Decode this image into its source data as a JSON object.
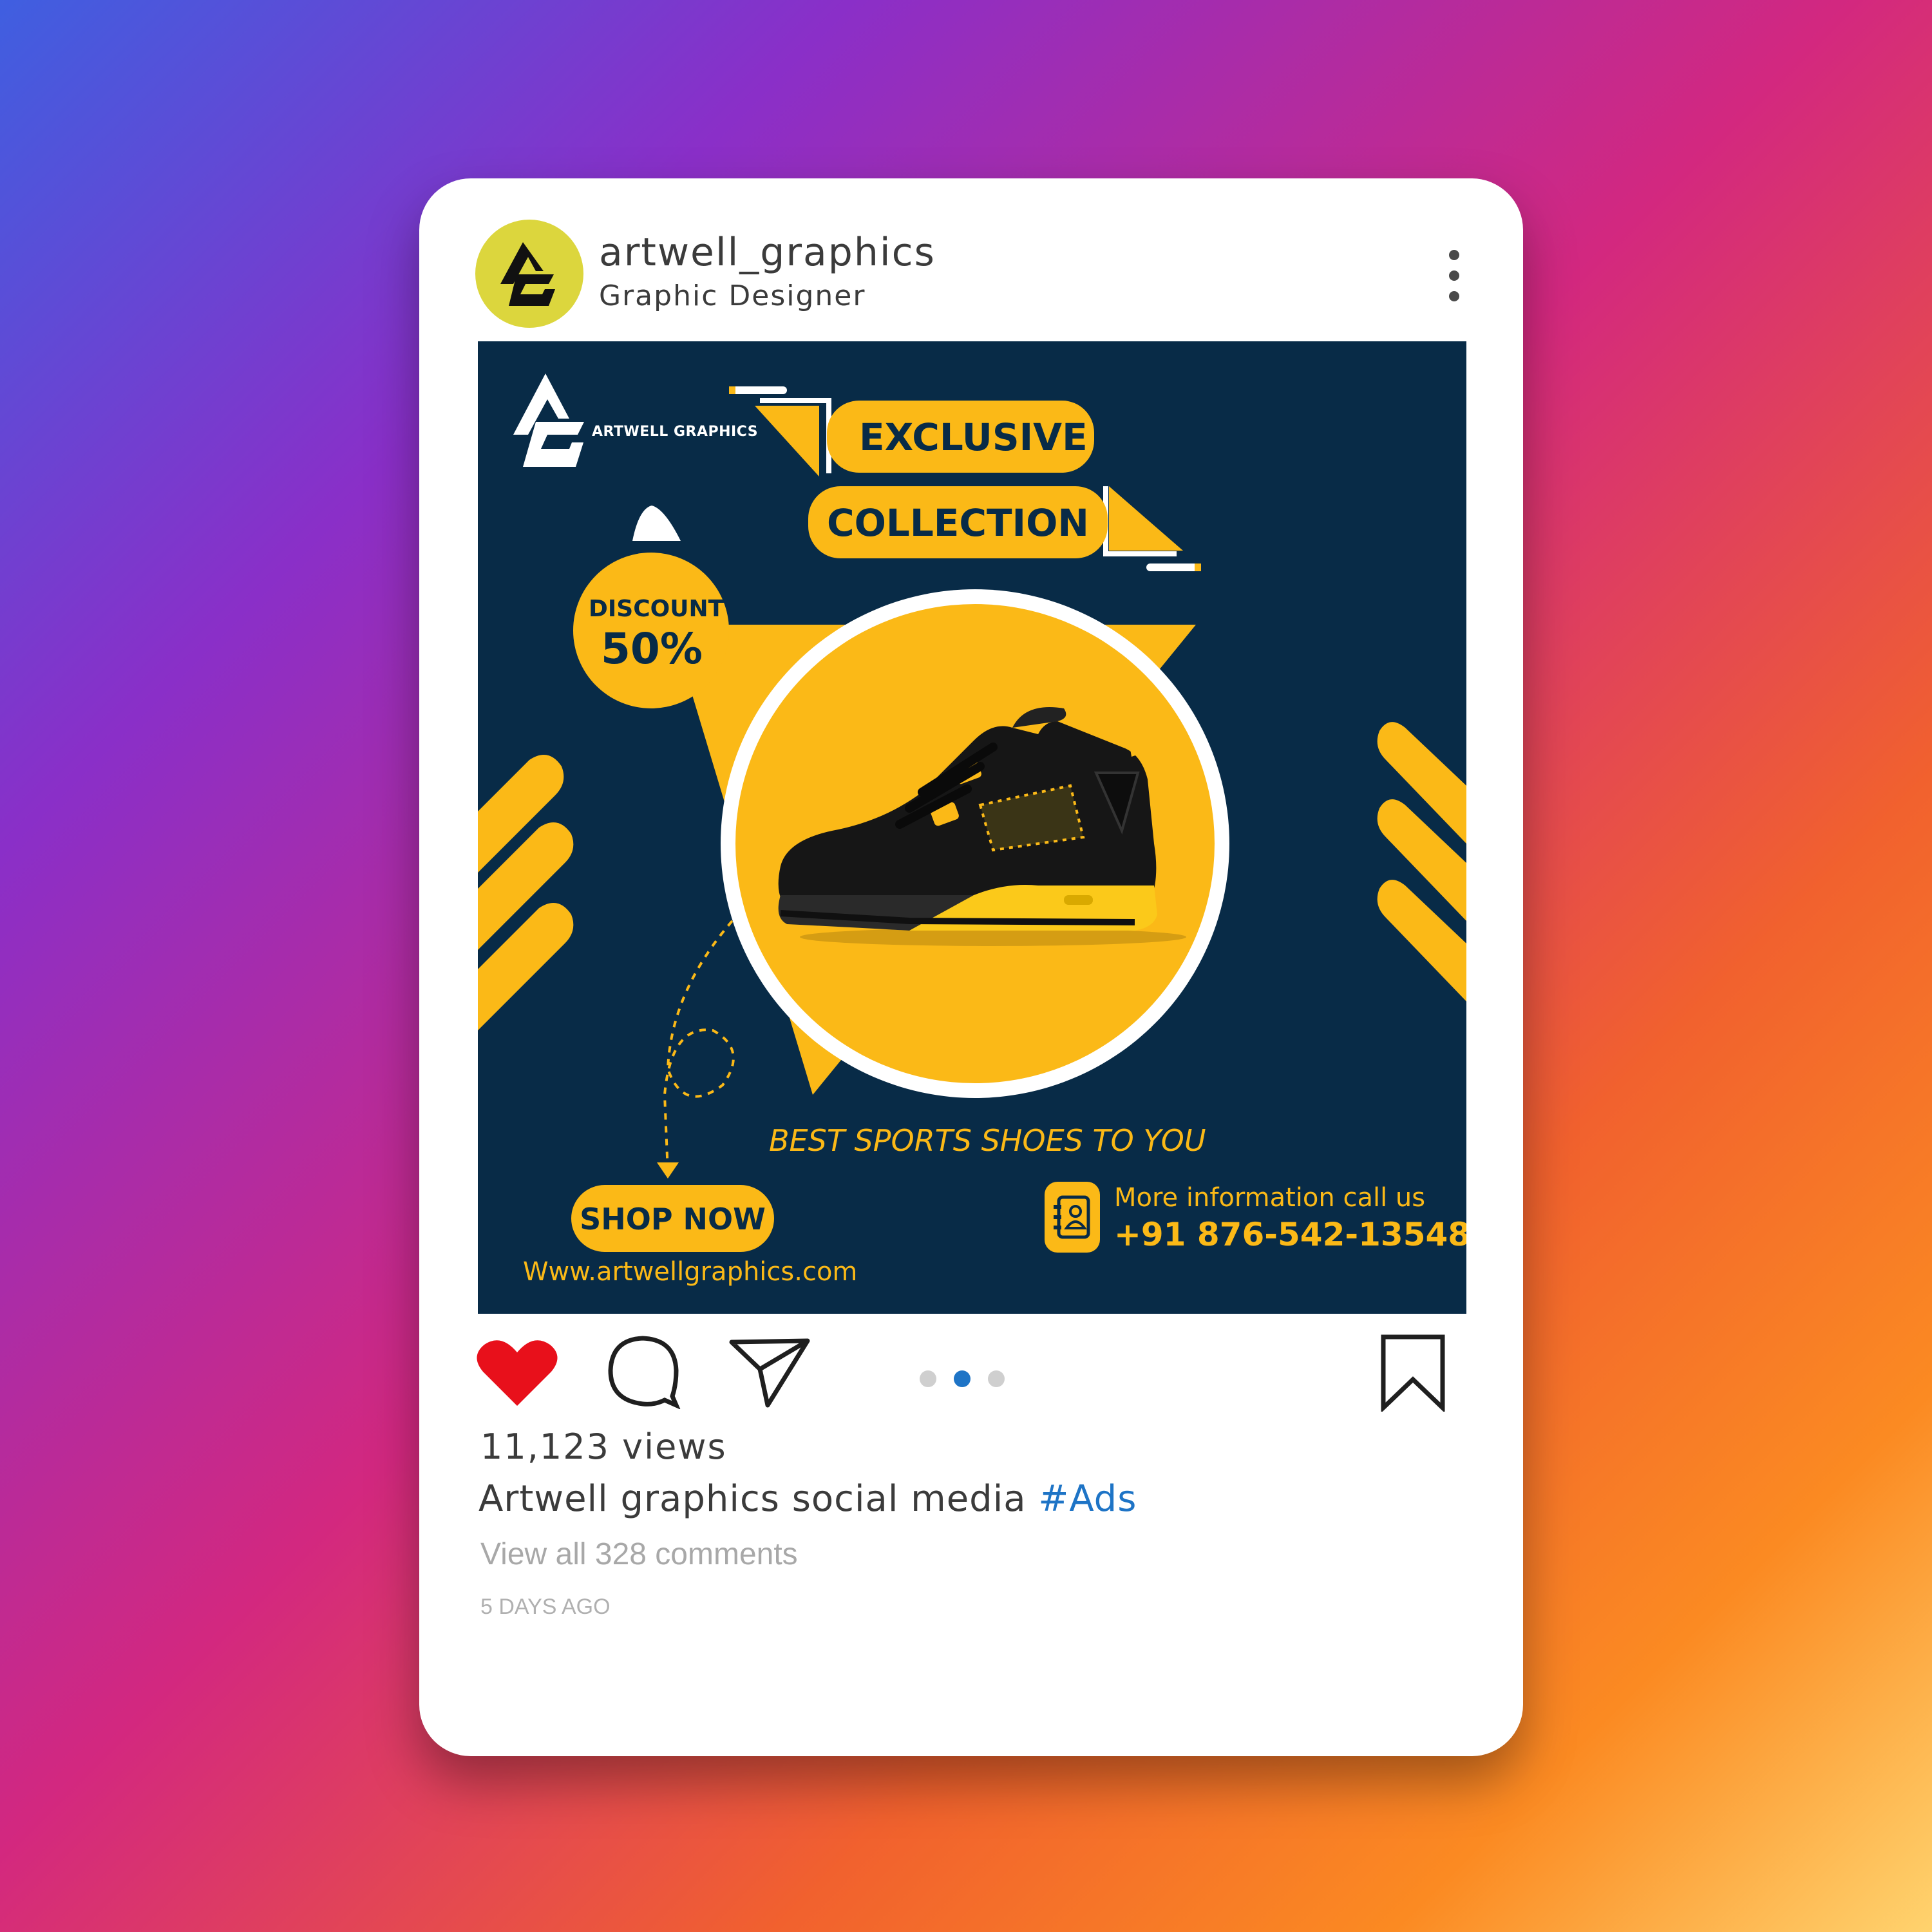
{
  "profile": {
    "username": "artwell_graphics",
    "subtitle": "Graphic Designer",
    "avatar_letters": "AG"
  },
  "post": {
    "brand": "ARTWELL GRAPHICS",
    "headline_1": "EXCLUSIVE",
    "headline_2": "COLLECTION",
    "discount_label": "DISCOUNT",
    "discount_value": "50%",
    "tagline": "BEST SPORTS SHOES TO YOU",
    "cta": "SHOP NOW",
    "website": "Www.artwellgraphics.com",
    "contact_label": "More information call us",
    "phone": "+91 876-542-13548"
  },
  "engagement": {
    "views": "11,123 views",
    "caption": "Artwell graphics social media",
    "hashtag": "#Ads",
    "comments_link": "View all 328 comments",
    "posted": "5 DAYS AGO",
    "carousel_active_index": 1,
    "carousel_count": 3
  },
  "colors": {
    "accent": "#fbb917",
    "navy": "#082b47",
    "like": "#e8101b",
    "link": "#1e74c6"
  },
  "icons": [
    "ag-logo-icon",
    "more-options-icon",
    "heart-icon",
    "comment-icon",
    "share-icon",
    "bookmark-icon",
    "contact-book-icon",
    "shoe-image"
  ]
}
